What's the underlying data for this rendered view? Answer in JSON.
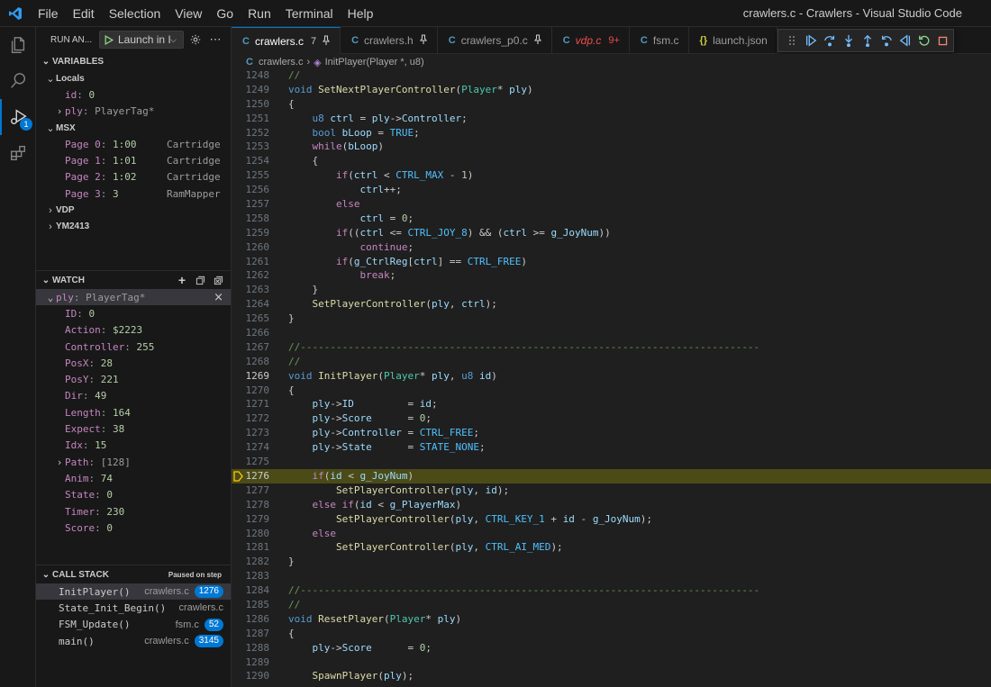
{
  "menu": [
    "File",
    "Edit",
    "Selection",
    "View",
    "Go",
    "Run",
    "Terminal",
    "Help"
  ],
  "window_title": "crawlers.c - Crawlers - Visual Studio Code",
  "activity": {
    "debug_badge": "1"
  },
  "run": {
    "title": "RUN AN...",
    "config_label": "Launch in I"
  },
  "variables": {
    "header": "VARIABLES",
    "locals_label": "Locals",
    "locals": [
      {
        "name": "id",
        "value": "0"
      },
      {
        "name": "ply",
        "value": "PlayerTag*"
      }
    ],
    "msx_label": "MSX",
    "msx": [
      {
        "name": "Page 0",
        "value": "1:00",
        "info": "Cartridge"
      },
      {
        "name": "Page 1",
        "value": "1:01",
        "info": "Cartridge"
      },
      {
        "name": "Page 2",
        "value": "1:02",
        "info": "Cartridge"
      },
      {
        "name": "Page 3",
        "value": "3",
        "info": "RamMapper"
      }
    ],
    "vdp_label": "VDP",
    "ym_label": "YM2413"
  },
  "watch": {
    "header": "WATCH",
    "expr_name": "ply",
    "expr_type": "PlayerTag*",
    "fields": [
      {
        "name": "ID",
        "value": "0"
      },
      {
        "name": "Action",
        "value": "$2223"
      },
      {
        "name": "Controller",
        "value": "255"
      },
      {
        "name": "PosX",
        "value": "28"
      },
      {
        "name": "PosY",
        "value": "221"
      },
      {
        "name": "Dir",
        "value": "49"
      },
      {
        "name": "Length",
        "value": "164"
      },
      {
        "name": "Expect",
        "value": "38"
      },
      {
        "name": "Idx",
        "value": "15"
      },
      {
        "name": "Path",
        "value": "[128]"
      },
      {
        "name": "Anim",
        "value": "74"
      },
      {
        "name": "State",
        "value": "0"
      },
      {
        "name": "Timer",
        "value": "230"
      },
      {
        "name": "Score",
        "value": "0"
      }
    ]
  },
  "callstack": {
    "header": "CALL STACK",
    "status": "Paused on step",
    "frames": [
      {
        "fn": "InitPlayer()",
        "file": "crawlers.c",
        "line": "1276"
      },
      {
        "fn": "State_Init_Begin()",
        "file": "crawlers.c",
        "line": ""
      },
      {
        "fn": "FSM_Update()",
        "file": "fsm.c",
        "line": "52"
      },
      {
        "fn": "main()",
        "file": "crawlers.c",
        "line": "3145"
      }
    ]
  },
  "tabs": [
    {
      "icon": "C",
      "name": "crawlers.c",
      "mod": "7",
      "pinned": true
    },
    {
      "icon": "C",
      "name": "crawlers.h",
      "mod": "",
      "pinned": true
    },
    {
      "icon": "C",
      "name": "crawlers_p0.c",
      "mod": "",
      "pinned": true
    },
    {
      "icon": "C",
      "name": "vdp.c",
      "mod": "9+",
      "pinned": false
    },
    {
      "icon": "C",
      "name": "fsm.c",
      "mod": "",
      "pinned": false
    },
    {
      "icon": "{}",
      "name": "launch.json",
      "mod": "",
      "pinned": false
    }
  ],
  "breadcrumb": {
    "file": "crawlers.c",
    "symbol": "InitPlayer(Player *, u8)"
  },
  "editor": {
    "current_line": 1276,
    "lines": [
      {
        "n": 1248,
        "t": "//"
      },
      {
        "n": 1249,
        "t": "void SetNextPlayerController(Player* ply)"
      },
      {
        "n": 1250,
        "t": "{"
      },
      {
        "n": 1251,
        "t": "    u8 ctrl = ply->Controller;"
      },
      {
        "n": 1252,
        "t": "    bool bLoop = TRUE;"
      },
      {
        "n": 1253,
        "t": "    while(bLoop)"
      },
      {
        "n": 1254,
        "t": "    {"
      },
      {
        "n": 1255,
        "t": "        if(ctrl < CTRL_MAX - 1)"
      },
      {
        "n": 1256,
        "t": "            ctrl++;"
      },
      {
        "n": 1257,
        "t": "        else"
      },
      {
        "n": 1258,
        "t": "            ctrl = 0;"
      },
      {
        "n": 1259,
        "t": "        if((ctrl <= CTRL_JOY_8) && (ctrl >= g_JoyNum))"
      },
      {
        "n": 1260,
        "t": "            continue;"
      },
      {
        "n": 1261,
        "t": "        if(g_CtrlReg[ctrl] == CTRL_FREE)"
      },
      {
        "n": 1262,
        "t": "            break;"
      },
      {
        "n": 1263,
        "t": "    }"
      },
      {
        "n": 1264,
        "t": "    SetPlayerController(ply, ctrl);"
      },
      {
        "n": 1265,
        "t": "}"
      },
      {
        "n": 1266,
        "t": ""
      },
      {
        "n": 1267,
        "t": "//-----------------------------------------------------------------------------"
      },
      {
        "n": 1268,
        "t": "//"
      },
      {
        "n": 1269,
        "t": "void InitPlayer(Player* ply, u8 id)"
      },
      {
        "n": 1270,
        "t": "{"
      },
      {
        "n": 1271,
        "t": "    ply->ID         = id;"
      },
      {
        "n": 1272,
        "t": "    ply->Score      = 0;"
      },
      {
        "n": 1273,
        "t": "    ply->Controller = CTRL_FREE;"
      },
      {
        "n": 1274,
        "t": "    ply->State      = STATE_NONE;"
      },
      {
        "n": 1275,
        "t": ""
      },
      {
        "n": 1276,
        "t": "    if(id < g_JoyNum)"
      },
      {
        "n": 1277,
        "t": "        SetPlayerController(ply, id);"
      },
      {
        "n": 1278,
        "t": "    else if(id < g_PlayerMax)"
      },
      {
        "n": 1279,
        "t": "        SetPlayerController(ply, CTRL_KEY_1 + id - g_JoyNum);"
      },
      {
        "n": 1280,
        "t": "    else"
      },
      {
        "n": 1281,
        "t": "        SetPlayerController(ply, CTRL_AI_MED);"
      },
      {
        "n": 1282,
        "t": "}"
      },
      {
        "n": 1283,
        "t": ""
      },
      {
        "n": 1284,
        "t": "//-----------------------------------------------------------------------------"
      },
      {
        "n": 1285,
        "t": "//"
      },
      {
        "n": 1286,
        "t": "void ResetPlayer(Player* ply)"
      },
      {
        "n": 1287,
        "t": "{"
      },
      {
        "n": 1288,
        "t": "    ply->Score      = 0;"
      },
      {
        "n": 1289,
        "t": ""
      },
      {
        "n": 1290,
        "t": "    SpawnPlayer(ply);"
      }
    ]
  },
  "colors": {
    "accent": "#0078d4",
    "current_line_bg": "#4b4b18",
    "debug_arrow": "#ffcc00",
    "keyword": "#569cd6",
    "control": "#c586c0",
    "function": "#dcdcaa",
    "type": "#4ec9b0",
    "variable": "#9cdcfe",
    "constant": "#4fc1ff",
    "number": "#b5cea8",
    "comment": "#6a9955"
  }
}
